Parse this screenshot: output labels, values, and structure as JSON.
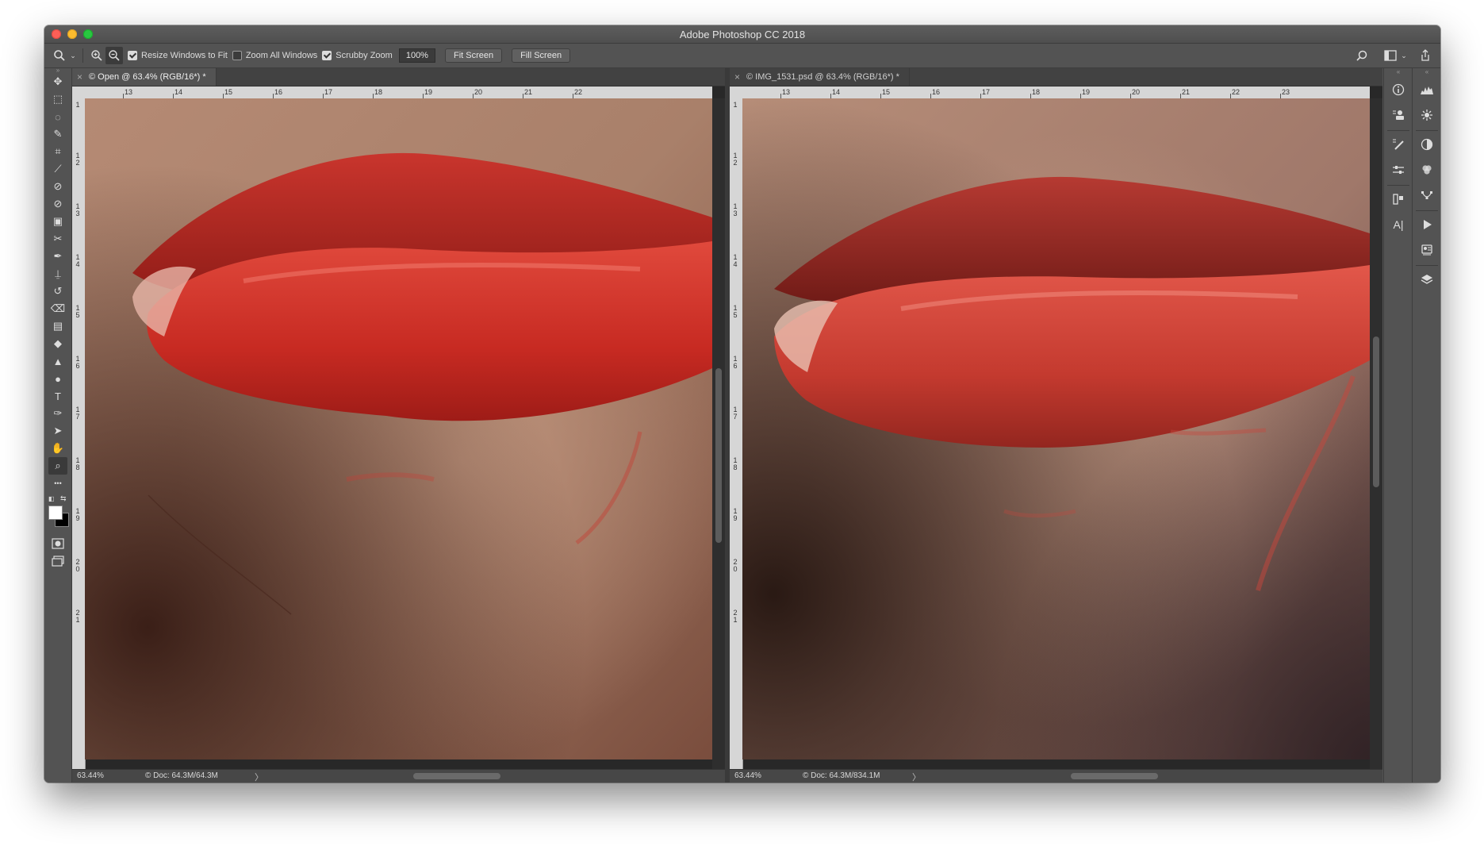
{
  "window": {
    "title": "Adobe Photoshop CC 2018"
  },
  "options_bar": {
    "resize_windows_label": "Resize Windows to Fit",
    "resize_windows_checked": true,
    "zoom_all_label": "Zoom All Windows",
    "zoom_all_checked": false,
    "scrubby_zoom_label": "Scrubby Zoom",
    "scrubby_zoom_checked": true,
    "zoom_value": "100%",
    "fit_screen_label": "Fit Screen",
    "fill_screen_label": "Fill Screen"
  },
  "documents": [
    {
      "tab_label": "© Open @ 63.4% (RGB/16*) *",
      "ruler_top": [
        "13",
        "14",
        "15",
        "16",
        "17",
        "18",
        "19",
        "20",
        "21",
        "22"
      ],
      "ruler_left": [
        "1",
        "1\n2",
        "1\n3",
        "1\n4",
        "1\n5",
        "1\n6",
        "1\n7",
        "1\n8",
        "1\n9",
        "2\n0",
        "2\n1"
      ],
      "status_zoom": "63.44%",
      "status_doc": "© Doc: 64.3M/64.3M",
      "status_arrow": "〉"
    },
    {
      "tab_label": "© IMG_1531.psd @ 63.4% (RGB/16*) *",
      "ruler_top": [
        "13",
        "14",
        "15",
        "16",
        "17",
        "18",
        "19",
        "20",
        "21",
        "22",
        "23"
      ],
      "ruler_left": [
        "1",
        "1\n2",
        "1\n3",
        "1\n4",
        "1\n5",
        "1\n6",
        "1\n7",
        "1\n8",
        "1\n9",
        "2\n0",
        "2\n1"
      ],
      "status_zoom": "63.44%",
      "status_doc": "© Doc: 64.3M/834.1M",
      "status_arrow": "〉"
    }
  ],
  "toolbar": {
    "tools": [
      "move-tool",
      "marquee-tool",
      "lasso-tool",
      "quick-selection-tool",
      "crop-tool",
      "eyedropper-tool",
      "spot-healing-tool",
      "healing-brush-tool",
      "patch-tool",
      "content-aware-move-tool",
      "brush-tool",
      "clone-stamp-tool",
      "history-brush-tool",
      "eraser-tool",
      "gradient-tool",
      "blur-tool",
      "sharpen-tool",
      "dodge-tool",
      "type-tool",
      "pen-tool",
      "path-selection-tool",
      "hand-tool",
      "zoom-tool",
      "more-tools"
    ],
    "active_tool": "zoom-tool",
    "foreground_color": "#ffffff",
    "background_color": "#000000"
  },
  "colors": {
    "accent": "#535353",
    "lip_red": "#c22a22",
    "skin": "#a98068"
  }
}
